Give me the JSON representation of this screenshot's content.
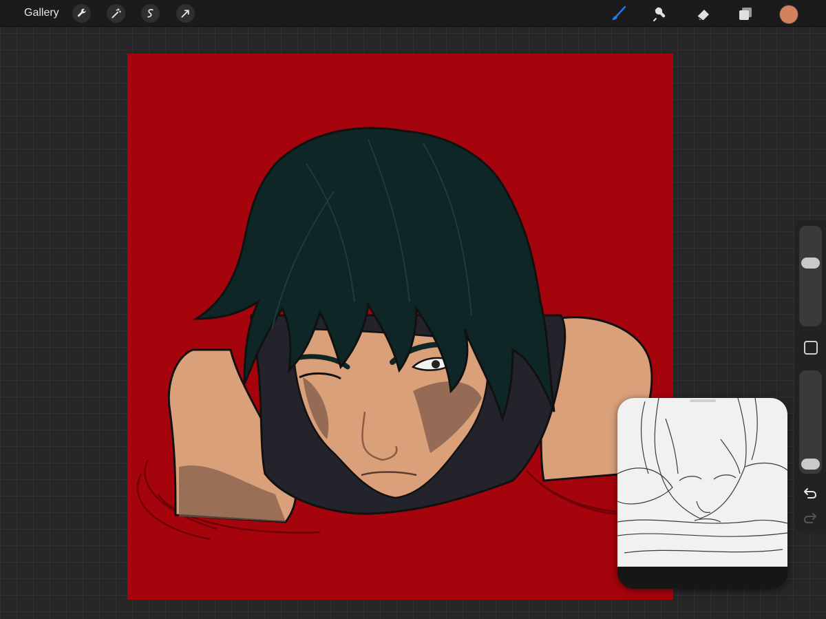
{
  "toolbar": {
    "gallery_label": "Gallery",
    "left_tools": [
      "wrench-icon",
      "magic-wand-icon",
      "selection-s-icon",
      "transform-arrow-icon"
    ],
    "right_tools": [
      "brush-icon",
      "smudge-icon",
      "eraser-icon",
      "layers-icon"
    ],
    "active_tool": "brush-icon",
    "active_color": "#d4825e",
    "accent": "#1a7cf5"
  },
  "canvas": {
    "background_color": "#a5040c",
    "hair_color": "#0e2626",
    "skin_color": "#d9a07a",
    "shirt_color": "#23232b"
  },
  "sidebar": {
    "brush_size_level": 0.65,
    "opacity_level": 0.02,
    "undo_icon": "undo-icon",
    "redo_icon": "redo-icon"
  },
  "reference": {
    "background": "#f1f1f1"
  }
}
